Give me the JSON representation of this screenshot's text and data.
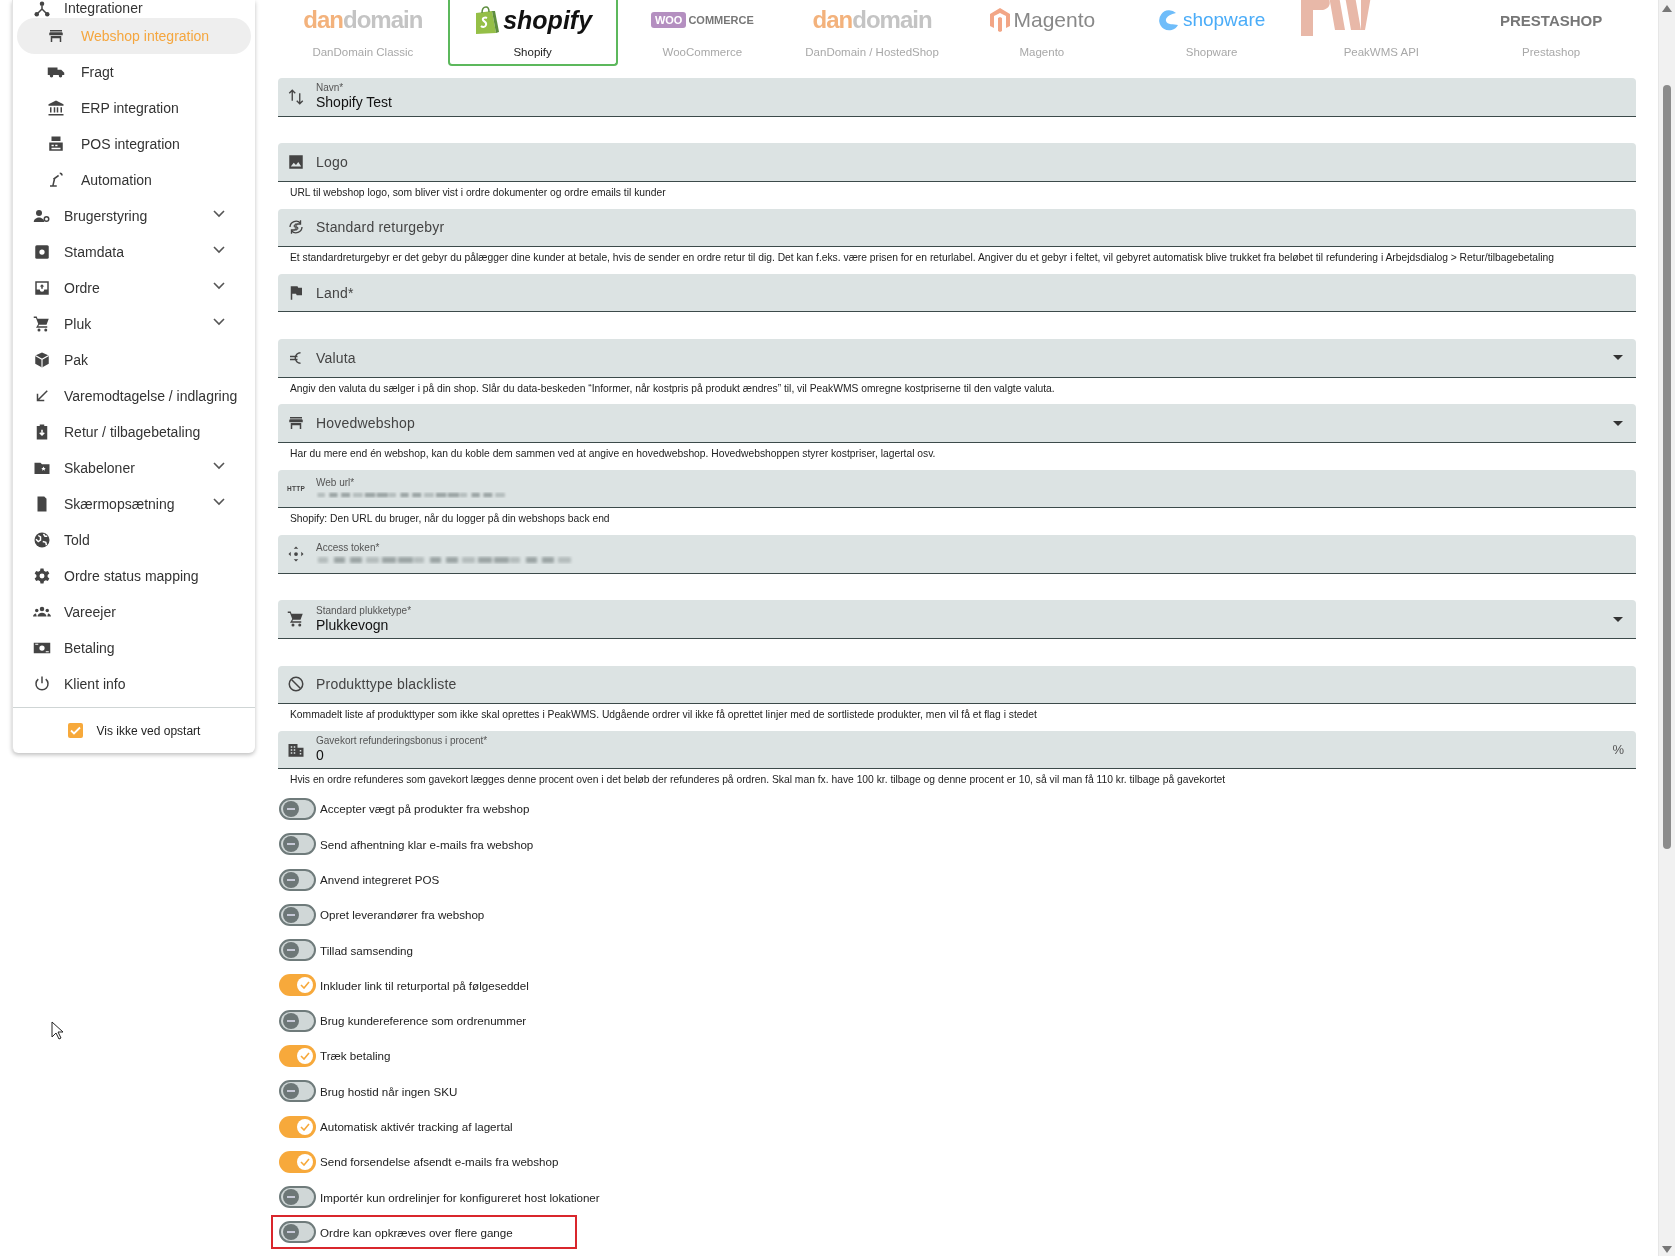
{
  "sidebar": {
    "items": [
      {
        "label": "Integrationer",
        "selected": false,
        "expandable": false,
        "children": [
          {
            "label": "Webshop integration",
            "selected": true
          },
          {
            "label": "Fragt",
            "selected": false
          },
          {
            "label": "ERP integration",
            "selected": false
          },
          {
            "label": "POS integration",
            "selected": false
          },
          {
            "label": "Automation",
            "selected": false
          }
        ]
      },
      {
        "label": "Brugerstyring",
        "selected": false,
        "expandable": true
      },
      {
        "label": "Stamdata",
        "selected": false,
        "expandable": true
      },
      {
        "label": "Ordre",
        "selected": false,
        "expandable": true
      },
      {
        "label": "Pluk",
        "selected": false,
        "expandable": true
      },
      {
        "label": "Pak",
        "selected": false,
        "expandable": false
      },
      {
        "label": "Varemodtagelse / indlagring",
        "selected": false,
        "expandable": false
      },
      {
        "label": "Retur / tilbagebetaling",
        "selected": false,
        "expandable": false
      },
      {
        "label": "Skabeloner",
        "selected": false,
        "expandable": true
      },
      {
        "label": "Skærmopsætning",
        "selected": false,
        "expandable": true
      },
      {
        "label": "Told",
        "selected": false,
        "expandable": false
      },
      {
        "label": "Ordre status mapping",
        "selected": false,
        "expandable": false
      },
      {
        "label": "Vareejer",
        "selected": false,
        "expandable": false
      },
      {
        "label": "Betaling",
        "selected": false,
        "expandable": false
      },
      {
        "label": "Klient info",
        "selected": false,
        "expandable": false
      }
    ],
    "startup_checkbox": {
      "label": "Vis ikke ved opstart",
      "checked": true
    }
  },
  "tabs": [
    {
      "label": "DanDomain Classic",
      "selected": false,
      "kind": "dandomain",
      "logo_text": [
        "dan",
        "domain"
      ]
    },
    {
      "label": "Shopify",
      "selected": true,
      "kind": "shopify",
      "logo_text": [
        "shopify"
      ]
    },
    {
      "label": "WooCommerce",
      "selected": false,
      "kind": "woocommerce",
      "logo_text": [
        "WOO",
        "COMMERCE"
      ]
    },
    {
      "label": "DanDomain / HostedShop",
      "selected": false,
      "kind": "dandomain",
      "logo_text": [
        "dan",
        "domain"
      ]
    },
    {
      "label": "Magento",
      "selected": false,
      "kind": "magento",
      "logo_text": [
        "Magento"
      ]
    },
    {
      "label": "Shopware",
      "selected": false,
      "kind": "shopware",
      "logo_text": [
        "shopware"
      ]
    },
    {
      "label": "PeakWMS API",
      "selected": false,
      "kind": "peakwms"
    },
    {
      "label": "Prestashop",
      "selected": false,
      "kind": "prestashop",
      "logo_text": [
        "PRESTASHOP"
      ]
    }
  ],
  "fields": [
    {
      "label": "Navn*",
      "value": "Shopify Test"
    },
    {
      "label": "Logo",
      "helper": "URL til webshop logo, som bliver vist i ordre dokumenter og ordre emails til kunder"
    },
    {
      "label": "Standard returgebyr",
      "helper": "Et standardreturgebyr er det gebyr du pålægger dine kunder at betale, hvis de sender en ordre retur til dig. Det kan f.eks. være prisen for en returlabel. Angiver du et gebyr i feltet, vil gebyret automatisk blive trukket fra beløbet til refundering i Arbejdsdialog > Retur/tilbagebetaling"
    },
    {
      "label": "Land*"
    },
    {
      "label": "Valuta",
      "dropdown": true,
      "helper": "Angiv den valuta du sælger i på din shop. Slår du data-beskeden “Informer, når kostpris på produkt ændres” til, vil PeakWMS omregne kostpriserne til den valgte valuta."
    },
    {
      "label": "Hovedwebshop",
      "dropdown": true,
      "helper": "Har du mere end én webshop, kan du koble dem sammen ved at angive en hovedwebshop. Hovedwebshoppen styrer kostpriser, lagertal osv."
    },
    {
      "label": "Web url*",
      "icon_text": "HTTP",
      "redacted": true,
      "helper": "Shopify: Den URL du bruger, når du logger på din webshops back end"
    },
    {
      "label": "Access token*",
      "redacted": true
    },
    {
      "label": "Standard plukketype*",
      "value": "Plukkevogn",
      "dropdown": true
    },
    {
      "label": "Produkttype blackliste",
      "helper": "Kommadelt liste af produkttyper som ikke skal oprettes i PeakWMS. Udgående ordrer vil ikke få oprettet linjer med de sortlistede produkter, men vil få et flag i stedet"
    },
    {
      "label": "Gavekort refunderingsbonus i procent*",
      "value": "0",
      "suffix": "%",
      "helper": "Hvis en ordre refunderes som gavekort lægges denne procent oven i det beløb der refunderes på ordren. Skal man fx. have 100 kr. tilbage og denne procent er 10, så vil man få 110 kr. tilbage på gavekortet"
    }
  ],
  "toggles": [
    {
      "label": "Accepter vægt på produkter fra webshop",
      "on": false,
      "highlighted": false
    },
    {
      "label": "Send afhentning klar e-mails fra webshop",
      "on": false,
      "highlighted": false
    },
    {
      "label": "Anvend integreret POS",
      "on": false,
      "highlighted": false
    },
    {
      "label": "Opret leverandører fra webshop",
      "on": false,
      "highlighted": false
    },
    {
      "label": "Tillad samsending",
      "on": false,
      "highlighted": false
    },
    {
      "label": "Inkluder link til returportal på følgeseddel",
      "on": true,
      "highlighted": false
    },
    {
      "label": "Brug kundereference som ordrenummer",
      "on": false,
      "highlighted": false
    },
    {
      "label": "Træk betaling",
      "on": true,
      "highlighted": false
    },
    {
      "label": "Brug hostid når ingen SKU",
      "on": false,
      "highlighted": false
    },
    {
      "label": "Automatisk aktivér tracking af lagertal",
      "on": true,
      "highlighted": false
    },
    {
      "label": "Send forsendelse afsendt e-mails fra webshop",
      "on": true,
      "highlighted": false
    },
    {
      "label": "Importér kun ordrelinjer for konfigureret host lokationer",
      "on": false,
      "highlighted": false
    },
    {
      "label": "Ordre kan opkræves over flere gange",
      "on": false,
      "highlighted": true
    }
  ]
}
